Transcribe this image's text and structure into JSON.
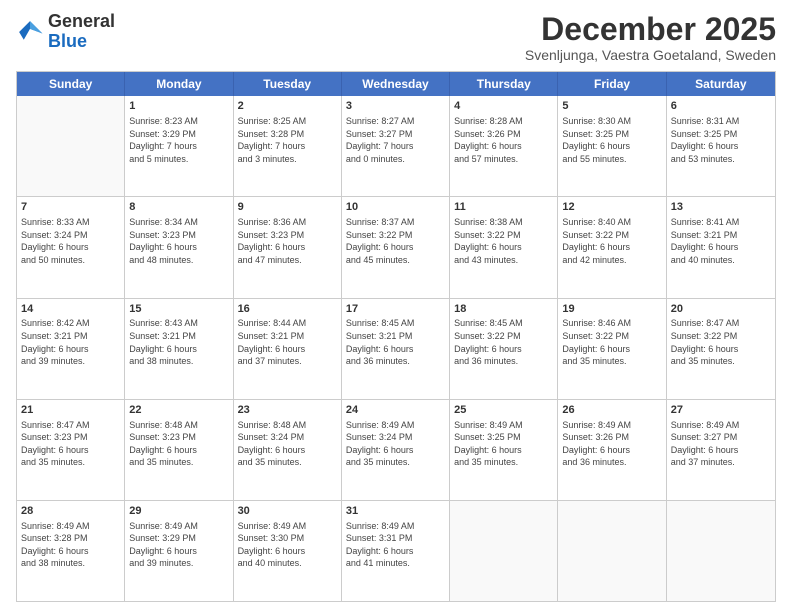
{
  "logo": {
    "general": "General",
    "blue": "Blue"
  },
  "title": "December 2025",
  "location": "Svenljunga, Vaestra Goetaland, Sweden",
  "header_days": [
    "Sunday",
    "Monday",
    "Tuesday",
    "Wednesday",
    "Thursday",
    "Friday",
    "Saturday"
  ],
  "weeks": [
    [
      {
        "day": "",
        "info": ""
      },
      {
        "day": "1",
        "info": "Sunrise: 8:23 AM\nSunset: 3:29 PM\nDaylight: 7 hours\nand 5 minutes."
      },
      {
        "day": "2",
        "info": "Sunrise: 8:25 AM\nSunset: 3:28 PM\nDaylight: 7 hours\nand 3 minutes."
      },
      {
        "day": "3",
        "info": "Sunrise: 8:27 AM\nSunset: 3:27 PM\nDaylight: 7 hours\nand 0 minutes."
      },
      {
        "day": "4",
        "info": "Sunrise: 8:28 AM\nSunset: 3:26 PM\nDaylight: 6 hours\nand 57 minutes."
      },
      {
        "day": "5",
        "info": "Sunrise: 8:30 AM\nSunset: 3:25 PM\nDaylight: 6 hours\nand 55 minutes."
      },
      {
        "day": "6",
        "info": "Sunrise: 8:31 AM\nSunset: 3:25 PM\nDaylight: 6 hours\nand 53 minutes."
      }
    ],
    [
      {
        "day": "7",
        "info": "Sunrise: 8:33 AM\nSunset: 3:24 PM\nDaylight: 6 hours\nand 50 minutes."
      },
      {
        "day": "8",
        "info": "Sunrise: 8:34 AM\nSunset: 3:23 PM\nDaylight: 6 hours\nand 48 minutes."
      },
      {
        "day": "9",
        "info": "Sunrise: 8:36 AM\nSunset: 3:23 PM\nDaylight: 6 hours\nand 47 minutes."
      },
      {
        "day": "10",
        "info": "Sunrise: 8:37 AM\nSunset: 3:22 PM\nDaylight: 6 hours\nand 45 minutes."
      },
      {
        "day": "11",
        "info": "Sunrise: 8:38 AM\nSunset: 3:22 PM\nDaylight: 6 hours\nand 43 minutes."
      },
      {
        "day": "12",
        "info": "Sunrise: 8:40 AM\nSunset: 3:22 PM\nDaylight: 6 hours\nand 42 minutes."
      },
      {
        "day": "13",
        "info": "Sunrise: 8:41 AM\nSunset: 3:21 PM\nDaylight: 6 hours\nand 40 minutes."
      }
    ],
    [
      {
        "day": "14",
        "info": "Sunrise: 8:42 AM\nSunset: 3:21 PM\nDaylight: 6 hours\nand 39 minutes."
      },
      {
        "day": "15",
        "info": "Sunrise: 8:43 AM\nSunset: 3:21 PM\nDaylight: 6 hours\nand 38 minutes."
      },
      {
        "day": "16",
        "info": "Sunrise: 8:44 AM\nSunset: 3:21 PM\nDaylight: 6 hours\nand 37 minutes."
      },
      {
        "day": "17",
        "info": "Sunrise: 8:45 AM\nSunset: 3:21 PM\nDaylight: 6 hours\nand 36 minutes."
      },
      {
        "day": "18",
        "info": "Sunrise: 8:45 AM\nSunset: 3:22 PM\nDaylight: 6 hours\nand 36 minutes."
      },
      {
        "day": "19",
        "info": "Sunrise: 8:46 AM\nSunset: 3:22 PM\nDaylight: 6 hours\nand 35 minutes."
      },
      {
        "day": "20",
        "info": "Sunrise: 8:47 AM\nSunset: 3:22 PM\nDaylight: 6 hours\nand 35 minutes."
      }
    ],
    [
      {
        "day": "21",
        "info": "Sunrise: 8:47 AM\nSunset: 3:23 PM\nDaylight: 6 hours\nand 35 minutes."
      },
      {
        "day": "22",
        "info": "Sunrise: 8:48 AM\nSunset: 3:23 PM\nDaylight: 6 hours\nand 35 minutes."
      },
      {
        "day": "23",
        "info": "Sunrise: 8:48 AM\nSunset: 3:24 PM\nDaylight: 6 hours\nand 35 minutes."
      },
      {
        "day": "24",
        "info": "Sunrise: 8:49 AM\nSunset: 3:24 PM\nDaylight: 6 hours\nand 35 minutes."
      },
      {
        "day": "25",
        "info": "Sunrise: 8:49 AM\nSunset: 3:25 PM\nDaylight: 6 hours\nand 35 minutes."
      },
      {
        "day": "26",
        "info": "Sunrise: 8:49 AM\nSunset: 3:26 PM\nDaylight: 6 hours\nand 36 minutes."
      },
      {
        "day": "27",
        "info": "Sunrise: 8:49 AM\nSunset: 3:27 PM\nDaylight: 6 hours\nand 37 minutes."
      }
    ],
    [
      {
        "day": "28",
        "info": "Sunrise: 8:49 AM\nSunset: 3:28 PM\nDaylight: 6 hours\nand 38 minutes."
      },
      {
        "day": "29",
        "info": "Sunrise: 8:49 AM\nSunset: 3:29 PM\nDaylight: 6 hours\nand 39 minutes."
      },
      {
        "day": "30",
        "info": "Sunrise: 8:49 AM\nSunset: 3:30 PM\nDaylight: 6 hours\nand 40 minutes."
      },
      {
        "day": "31",
        "info": "Sunrise: 8:49 AM\nSunset: 3:31 PM\nDaylight: 6 hours\nand 41 minutes."
      },
      {
        "day": "",
        "info": ""
      },
      {
        "day": "",
        "info": ""
      },
      {
        "day": "",
        "info": ""
      }
    ]
  ]
}
